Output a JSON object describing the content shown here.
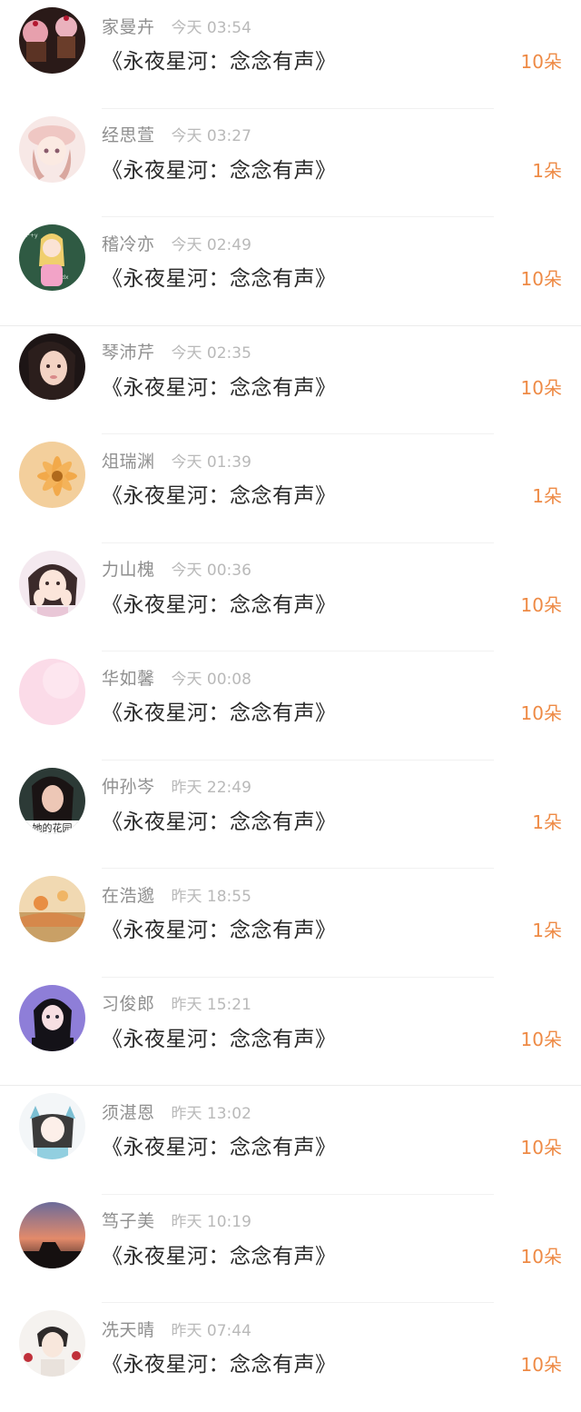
{
  "gifts": [
    {
      "user": "家曼卉",
      "time": "今天 03:54",
      "work": "《永夜星河：念念有声》",
      "count": "10朵",
      "avatar": "cupcake-avatar"
    },
    {
      "user": "经思萱",
      "time": "今天 03:27",
      "work": "《永夜星河：念念有声》",
      "count": "1朵",
      "avatar": "anime-girl-avatar"
    },
    {
      "user": "稽冷亦",
      "time": "今天 02:49",
      "work": "《永夜星河：念念有声》",
      "count": "10朵",
      "avatar": "chalkboard-girl-avatar"
    },
    {
      "user": "琴沛芹",
      "time": "今天 02:35",
      "work": "《永夜星河：念念有声》",
      "count": "10朵",
      "avatar": "portrait-avatar"
    },
    {
      "user": "俎瑞渊",
      "time": "今天 01:39",
      "work": "《永夜星河：念念有声》",
      "count": "1朵",
      "avatar": "flower-avatar"
    },
    {
      "user": "力山槐",
      "time": "今天 00:36",
      "work": "《永夜星河：念念有声》",
      "count": "10朵",
      "avatar": "cartoon-girl-avatar"
    },
    {
      "user": "华如馨",
      "time": "今天 00:08",
      "work": "《永夜星河：念念有声》",
      "count": "10朵",
      "avatar": "pink-avatar"
    },
    {
      "user": "仲孙岑",
      "time": "昨天 22:49",
      "work": "《永夜星河：念念有声》",
      "count": "1朵",
      "avatar": "photo-girl-avatar",
      "avatar_text": "她的花园"
    },
    {
      "user": "在浩邈",
      "time": "昨天 18:55",
      "work": "《永夜星河：念念有声》",
      "count": "1朵",
      "avatar": "meadow-avatar"
    },
    {
      "user": "习俊郎",
      "time": "昨天 15:21",
      "work": "《永夜星河：念念有声》",
      "count": "10朵",
      "avatar": "purple-girl-avatar"
    },
    {
      "user": "须湛恩",
      "time": "昨天 13:02",
      "work": "《永夜星河：念念有声》",
      "count": "10朵",
      "avatar": "cat-ear-girl-avatar"
    },
    {
      "user": "笃子美",
      "time": "昨天 10:19",
      "work": "《永夜星河：念念有声》",
      "count": "10朵",
      "avatar": "sunset-avatar"
    },
    {
      "user": "冼天晴",
      "time": "昨天 07:44",
      "work": "《永夜星河：念念有声》",
      "count": "10朵",
      "avatar": "boy-roses-avatar"
    }
  ],
  "colors": {
    "count": "#ee8a45",
    "name": "#8f8f8f",
    "time": "#b9b9b9",
    "title": "#2b2b2b"
  }
}
